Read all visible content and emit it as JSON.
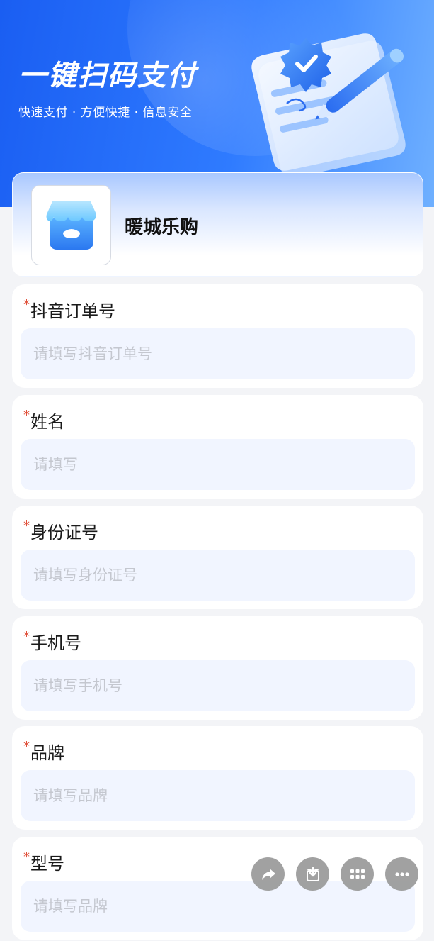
{
  "hero": {
    "title": "一键扫码支付",
    "subtitle": "快速支付 · 方便快捷 · 信息安全"
  },
  "store": {
    "name": "暖城乐购"
  },
  "form": {
    "required_mark": "*",
    "fields": [
      {
        "label": "抖音订单号",
        "placeholder": "请填写抖音订单号"
      },
      {
        "label": "姓名",
        "placeholder": "请填写"
      },
      {
        "label": "身份证号",
        "placeholder": "请填写身份证号"
      },
      {
        "label": "手机号",
        "placeholder": "请填写手机号"
      },
      {
        "label": "品牌",
        "placeholder": "请填写品牌"
      },
      {
        "label": "型号",
        "placeholder": "请填写品牌"
      }
    ]
  },
  "floating_actions": [
    {
      "icon": "share-icon"
    },
    {
      "icon": "download-icon"
    },
    {
      "icon": "grid-menu-icon"
    },
    {
      "icon": "more-icon"
    }
  ],
  "colors": {
    "hero_blue": "#1a5ef2",
    "required_red": "#e0503a",
    "input_bg": "#f1f5ff",
    "page_bg": "#f3f4f7"
  }
}
